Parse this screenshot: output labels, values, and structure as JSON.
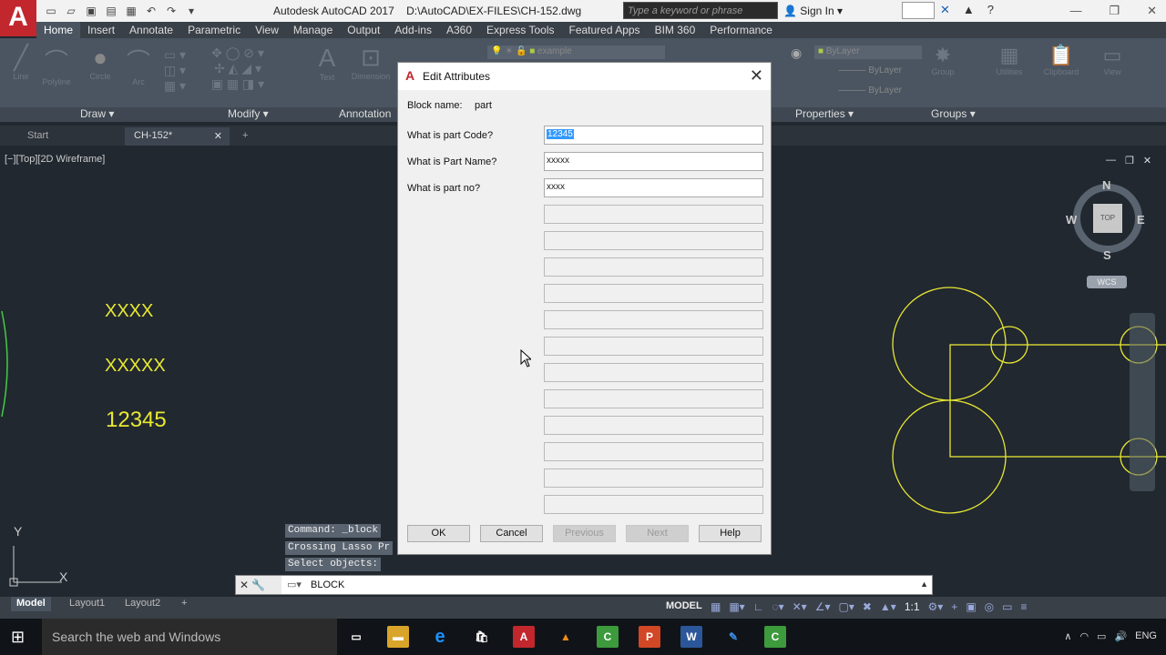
{
  "app": {
    "logo": "A",
    "title": "Autodesk AutoCAD 2017",
    "file_path": "D:\\AutoCAD\\EX-FILES\\CH-152.dwg",
    "search_placeholder": "Type a keyword or phrase",
    "sign_in": "Sign In"
  },
  "ribbon": {
    "tabs": [
      "Home",
      "Insert",
      "Annotate",
      "Parametric",
      "View",
      "Manage",
      "Output",
      "Add-ins",
      "A360",
      "Express Tools",
      "Featured Apps",
      "BIM 360",
      "Performance"
    ],
    "active_tab": "Home",
    "tools": [
      "Line",
      "Polyline",
      "Circle",
      "Arc",
      "Text",
      "Dimension"
    ],
    "groups": [
      "Draw",
      "Modify",
      "Annotation",
      "Properties",
      "Groups"
    ],
    "layer_name": "example",
    "bylayer": "ByLayer",
    "bylayer2": "ByLayer",
    "bylayer3": "ByLayer",
    "group_label": "Group",
    "utilities": "Utilities",
    "clipboard": "Clipboard",
    "view": "View"
  },
  "doc_tabs": {
    "start": "Start",
    "current": "CH-152*"
  },
  "viewport": {
    "label": "[−][Top][2D Wireframe]",
    "attr_values": [
      "XXXX",
      "XXXXX",
      "12345"
    ],
    "viewcube": {
      "top": "TOP",
      "n": "N",
      "s": "S",
      "e": "E",
      "w": "W",
      "wcs": "WCS"
    },
    "ucs_y": "Y",
    "ucs_x": "X"
  },
  "command": {
    "history": [
      "Command: _block",
      "Crossing Lasso  Pr",
      "Select objects:"
    ],
    "current": "BLOCK"
  },
  "status": {
    "layouts": [
      "Model",
      "Layout1",
      "Layout2"
    ],
    "model": "MODEL",
    "scale": "1:1"
  },
  "taskbar": {
    "search": "Search the web and Windows",
    "lang": "ENG"
  },
  "dialog": {
    "title": "Edit Attributes",
    "block_label": "Block name:",
    "block_value": "part",
    "prompts": [
      "What is part Code?",
      "What is Part Name?",
      "What is part no?"
    ],
    "values": [
      "12345",
      "xxxxx",
      "xxxx"
    ],
    "buttons": {
      "ok": "OK",
      "cancel": "Cancel",
      "previous": "Previous",
      "next": "Next",
      "help": "Help"
    }
  },
  "colors": {
    "accent_red": "#c1272d",
    "attr_yellow": "#e8e832",
    "canvas": "#212830"
  }
}
